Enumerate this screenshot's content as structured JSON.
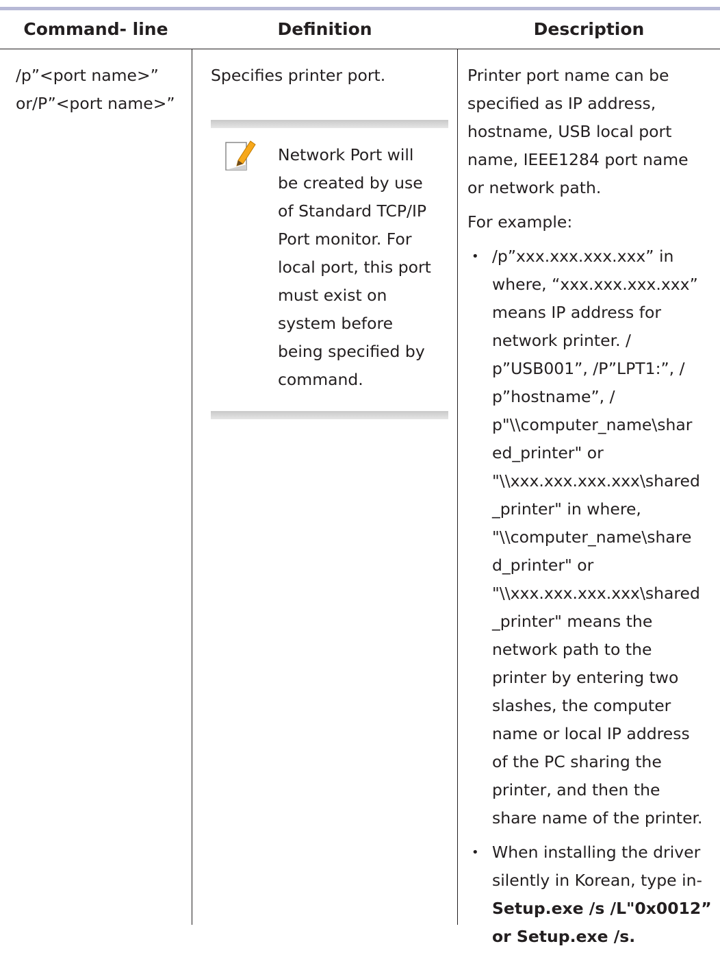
{
  "table": {
    "headers": {
      "command_line": "Command- line",
      "definition": "Definition",
      "description": "Description"
    },
    "row": {
      "command_line": [
        "/p”<port name>”",
        "or/P”<port name>”"
      ],
      "definition": "Specifies printer port.",
      "note": [
        "Network Port will",
        "be created by use",
        "of Standard TCP/IP",
        "Port monitor. For",
        "local port, this port",
        "must exist on",
        "system before",
        "being specified by",
        "command."
      ],
      "description_intro": [
        "Printer port name can be",
        "specified as IP address,",
        "hostname, USB local port",
        "name, IEEE1284 port name",
        "or network path."
      ],
      "example_label": "For example:",
      "bullet1": [
        "/p”xxx.xxx.xxx.xxx” in",
        "where, “xxx.xxx.xxx.xxx”",
        "means IP address for",
        "network printer. /",
        "p”USB001”, /P”LPT1:”, /",
        "p”hostname”, /",
        "p\"\\\\computer_name\\shar",
        "ed_printer\" or",
        "\"\\\\xxx.xxx.xxx.xxx\\shared",
        "_printer\" in where,",
        "\"\\\\computer_name\\share",
        "d_printer\" or",
        "\"\\\\xxx.xxx.xxx.xxx\\shared",
        "_printer\" means the",
        "network path to the",
        "printer by entering two",
        "slashes, the computer",
        "name or local IP address",
        "of the PC sharing the",
        "printer, and then the",
        "share name of the printer."
      ],
      "bullet2_plain": [
        "When installing the driver",
        "silently in Korean, type in-"
      ],
      "bullet2_bold": [
        "Setup.exe /s /L\"0x0012”",
        "or Setup.exe /s."
      ]
    }
  },
  "colors": {
    "top_rule": "#b7b9d6",
    "text": "#231f20",
    "note_bar": "#d4d4d4",
    "note_pencil": "#f7a81b"
  }
}
